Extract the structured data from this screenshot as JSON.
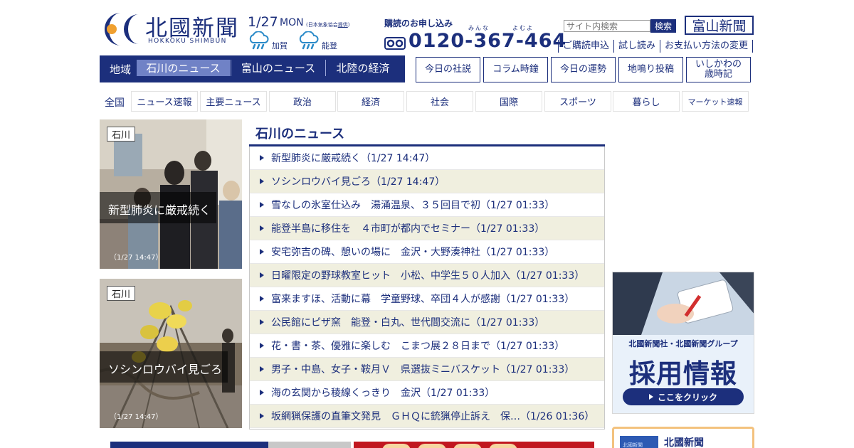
{
  "header": {
    "logo_title": "北國新聞",
    "logo_sub": "HOKKOKU SHIMBUN",
    "date": "1/27",
    "day_of_week": "MON",
    "weather_credit_prefix": "(日本気象協会",
    "weather_credit_link": "提供",
    "weather_credit_suffix": ")",
    "weather": [
      {
        "area": "加賀",
        "icon": "rain-cloud-icon"
      },
      {
        "area": "能登",
        "icon": "rain-cloud-icon"
      }
    ],
    "subscription_title": "購読のお申し込み",
    "ruby_a": "みんな",
    "ruby_b": "よむよ",
    "phone": "0120-367-464",
    "search_placeholder": "サイト内検索",
    "search_button": "検索",
    "toyama_logo": "富山新聞",
    "util_links": [
      "ご購読申込",
      "試し読み",
      "お支払い方法の変更"
    ]
  },
  "region_nav": {
    "label": "地域",
    "tabs": [
      "石川のニュース",
      "富山のニュース",
      "北陸の経済"
    ],
    "active_tab": "石川のニュース"
  },
  "feature_buttons": [
    "今日の社説",
    "コラム時鐘",
    "今日の運勢",
    "地鳴り投稿",
    "いしかわの\n歳時記"
  ],
  "category_nav": {
    "label": "全国",
    "items": [
      "ニュース速報",
      "主要ニュース",
      "政治",
      "経済",
      "社会",
      "国際",
      "スポーツ",
      "暮らし",
      "マーケット速報"
    ]
  },
  "photo_cards": [
    {
      "badge": "石川",
      "caption": "新型肺炎に厳戒続く",
      "time": "（1/27 14:47）"
    },
    {
      "badge": "石川",
      "caption": "ソシンロウバイ見ごろ",
      "time": "（1/27 14:47）"
    }
  ],
  "news": {
    "title": "石川のニュース",
    "items": [
      "新型肺炎に厳戒続く（1/27 14:47）",
      "ソシンロウバイ見ごろ（1/27 14:47）",
      "雪なしの氷室仕込み　湯涌温泉、３５回目で初（1/27 01:33）",
      "能登半島に移住を　４市町が都内でセミナー（1/27 01:33）",
      "安宅弥吉の碑、憩いの場に　金沢・大野湊神社（1/27 01:33）",
      "日曜限定の野球教室ヒット　小松、中学生５０人加入（1/27 01:33）",
      "富来ますほ、活動に幕　学童野球、卒団４人が感謝（1/27 01:33）",
      "公民館にピザ窯　能登・白丸、世代間交流に（1/27 01:33）",
      "花・書・茶、優雅に楽しむ　こまつ展２８日まで（1/27 01:33）",
      "男子・中島、女子・鞍月Ｖ　県選抜ミニバスケット（1/27 01:33）",
      "海の玄関から稜線くっきり　金沢（1/27 01:33）",
      "坂網猟保護の直筆文発見　ＧＨＱに銃猟停止訴え　保…（1/26 01:36）"
    ]
  },
  "recruit_banner": {
    "line1": "北國新聞社・北國新聞グループ",
    "line2": "採用情報",
    "cta": "ここをクリック"
  },
  "app_promo": {
    "icon_text": "北國新聞",
    "label": "北國新聞"
  },
  "colors": {
    "brand_navy": "#1c2f7c",
    "active_tab": "#7082c6",
    "stripe_row": "#f0efdf",
    "logo_orange": "#f0a030"
  }
}
